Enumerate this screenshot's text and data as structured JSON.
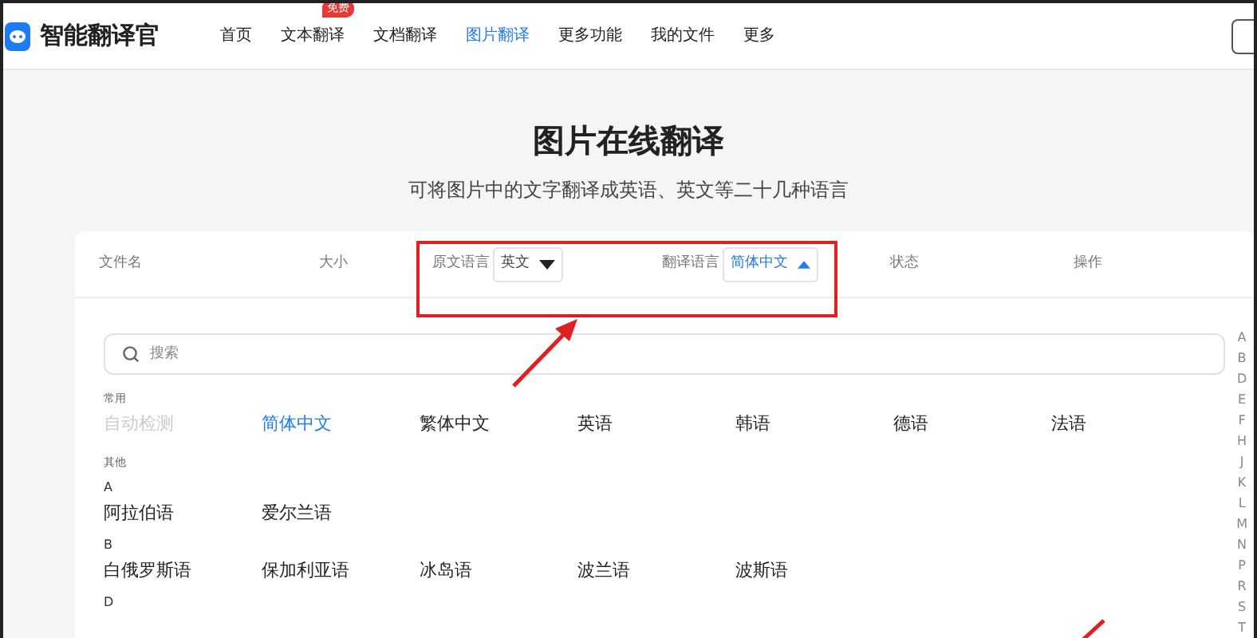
{
  "app": {
    "name": "智能翻译官"
  },
  "nav": [
    {
      "label": "首页",
      "selected": false
    },
    {
      "label": "文本翻译",
      "selected": false,
      "badge": "免费"
    },
    {
      "label": "文档翻译",
      "selected": false
    },
    {
      "label": "图片翻译",
      "selected": true
    },
    {
      "label": "更多功能",
      "selected": false
    },
    {
      "label": "我的文件",
      "selected": false
    },
    {
      "label": "更多",
      "selected": false
    }
  ],
  "page": {
    "title": "图片在线翻译",
    "subtitle": "可将图片中的文字翻译成英语、英文等二十几种语言"
  },
  "table": {
    "columns": [
      {
        "kind": "text",
        "label": "文件名"
      },
      {
        "kind": "text",
        "label": "大小"
      },
      {
        "kind": "select",
        "label": "原文语言",
        "value": "英文",
        "expanded": false
      },
      {
        "kind": "select",
        "label": "翻译语言",
        "value": "简体中文",
        "expanded": true
      },
      {
        "kind": "text",
        "label": "状态"
      },
      {
        "kind": "text",
        "label": "操作"
      }
    ]
  },
  "language_panel": {
    "search": {
      "placeholder": "搜索"
    },
    "common": {
      "heading": "常用",
      "items": [
        {
          "label": "自动检测",
          "selected": false,
          "disabled": true
        },
        {
          "label": "简体中文",
          "selected": true,
          "disabled": false
        },
        {
          "label": "繁体中文",
          "selected": false,
          "disabled": false
        },
        {
          "label": "英语",
          "selected": false,
          "disabled": false
        },
        {
          "label": "韩语",
          "selected": false,
          "disabled": false
        },
        {
          "label": "德语",
          "selected": false,
          "disabled": false
        },
        {
          "label": "法语",
          "selected": false,
          "disabled": false
        }
      ]
    },
    "others": {
      "heading": "其他",
      "groups": [
        {
          "letter": "A",
          "items": [
            "阿拉伯语",
            "爱尔兰语"
          ]
        },
        {
          "letter": "B",
          "items": [
            "白俄罗斯语",
            "保加利亚语",
            "冰岛语",
            "波兰语",
            "波斯语"
          ]
        },
        {
          "letter": "D"
        }
      ]
    },
    "alphabet_index": [
      "A",
      "B",
      "D",
      "E",
      "F",
      "H",
      "J",
      "K",
      "L",
      "M",
      "N",
      "P",
      "R",
      "S",
      "T"
    ]
  }
}
